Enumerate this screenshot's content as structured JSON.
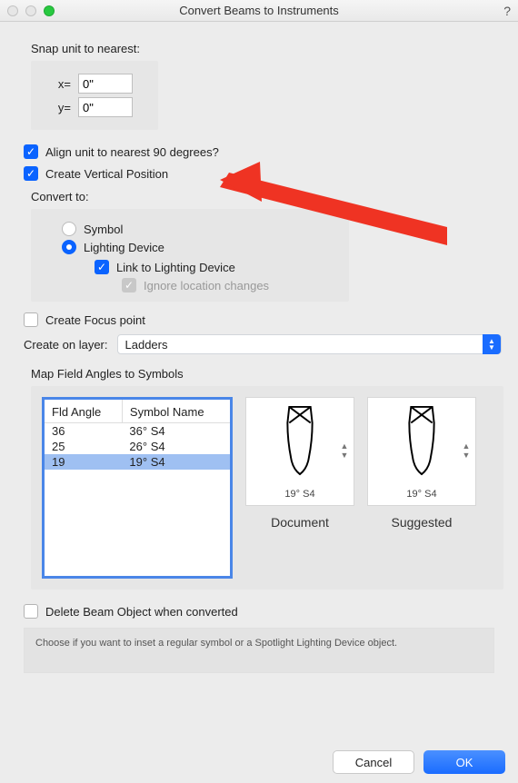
{
  "window": {
    "title": "Convert Beams to Instruments",
    "help": "?"
  },
  "snap": {
    "section": "Snap unit to nearest:",
    "x_label": "x=",
    "y_label": "y=",
    "x_value": "0\"",
    "y_value": "0\""
  },
  "checks": {
    "align_label": "Align unit to nearest 90 degrees?",
    "vertical_label": "Create Vertical Position",
    "focus_label": "Create Focus point",
    "delete_label": "Delete Beam Object when converted"
  },
  "convert": {
    "section": "Convert to:",
    "symbol": "Symbol",
    "lighting": "Lighting Device",
    "link": "Link to Lighting Device",
    "ignore": "Ignore location changes"
  },
  "layer": {
    "label": "Create on layer:",
    "value": "Ladders"
  },
  "map": {
    "section": "Map Field Angles to Symbols",
    "columns": {
      "angle": "Fld Angle",
      "name": "Symbol Name"
    },
    "rows": [
      {
        "angle": "36",
        "name": "36° S4"
      },
      {
        "angle": "25",
        "name": "26° S4"
      },
      {
        "angle": "19",
        "name": "19° S4"
      }
    ],
    "selected_index": 2,
    "preview": {
      "doc_label": "19° S4",
      "doc_caption": "Document",
      "sug_label": "19° S4",
      "sug_caption": "Suggested"
    }
  },
  "hint": "Choose if you want to inset a regular symbol or a Spotlight Lighting Device object.",
  "buttons": {
    "cancel": "Cancel",
    "ok": "OK"
  }
}
